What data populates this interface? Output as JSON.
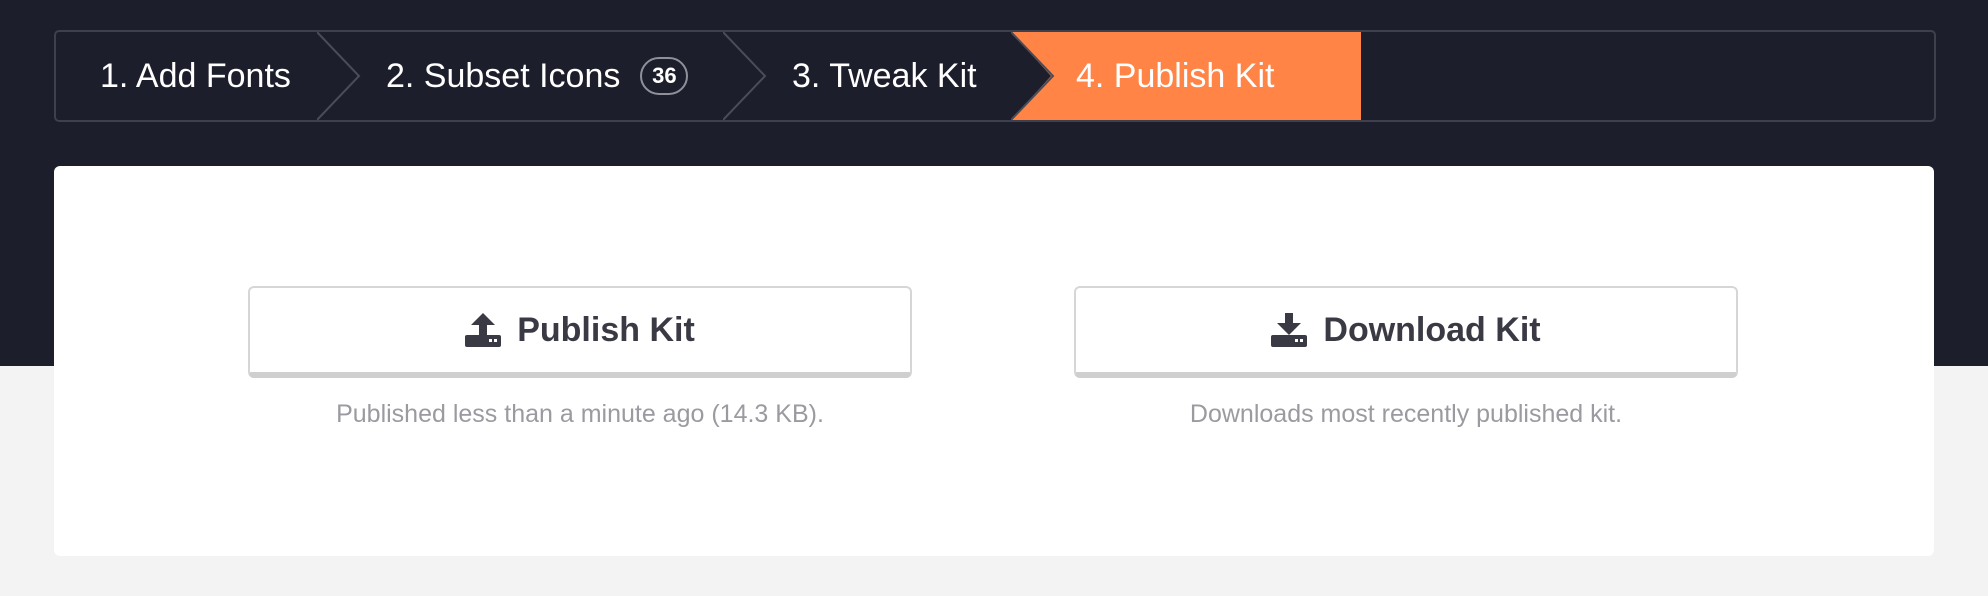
{
  "stepper": {
    "steps": [
      {
        "label": "1. Add Fonts"
      },
      {
        "label": "2. Subset Icons",
        "badge": "36"
      },
      {
        "label": "3. Tweak Kit"
      },
      {
        "label": "4. Publish Kit",
        "active": true
      }
    ],
    "active_color": "#ff8446"
  },
  "actions": {
    "publish": {
      "label": "Publish Kit",
      "icon": "upload-icon",
      "caption": "Published less than a minute ago (14.3 KB)."
    },
    "download": {
      "label": "Download Kit",
      "icon": "download-icon",
      "caption": "Downloads most recently published kit."
    }
  },
  "colors": {
    "header_bg": "#1d1e2b",
    "page_bg": "#f3f3f3",
    "text_dark": "#3a3a44",
    "caption": "#9a9aa0"
  }
}
